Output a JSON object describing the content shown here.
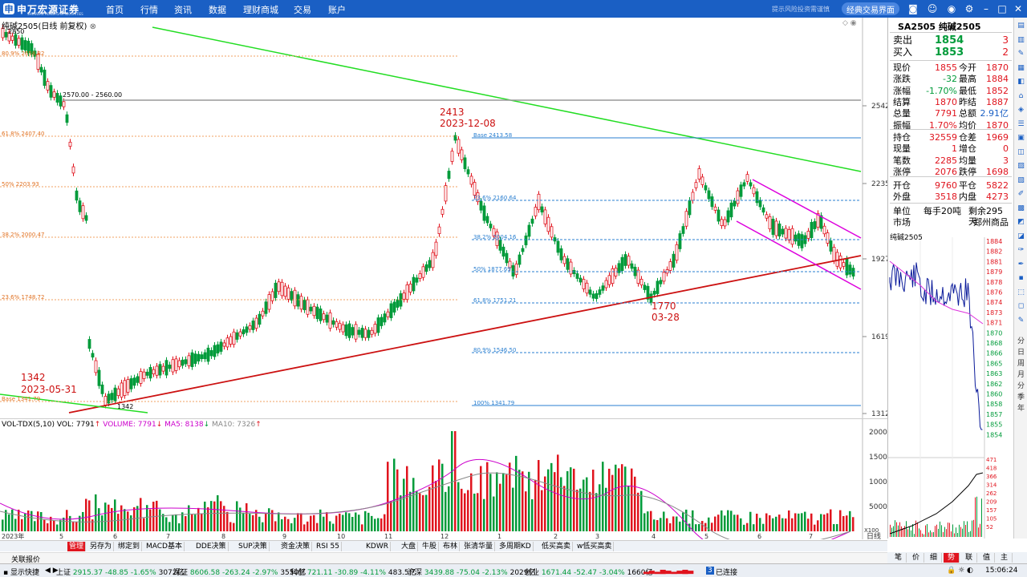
{
  "app": {
    "logo_text": "申万宏源证券",
    "logo_sub": "SHENWAN HONGYUAN SECURITIES",
    "nav": [
      "首页",
      "行情",
      "资讯",
      "数据",
      "理财商城",
      "交易",
      "账户"
    ],
    "topright_text": "提示风险投资需谨慎",
    "classic_button": "经典交易界面"
  },
  "chart": {
    "title": "纯碱2505(日线 前复权)",
    "annotations": {
      "high_price": "2413",
      "high_date": "2023-12-08",
      "low1_price": "1342",
      "low1_date": "2023-05-31",
      "low2_price": "1770",
      "low2_date": "03-28",
      "top_label": "2850",
      "range_label": "2570.00 - 2560.00",
      "bottom_marker": "1342"
    },
    "fib_left": [
      "80.9% 2658.82",
      "61.8% 2407.40",
      "50% 2203.93",
      "38.2% 2000.47",
      "23.6% 1748.72",
      "Base 1341.79"
    ],
    "fib_right": [
      "Base 2413.58",
      "23.6% 2160.64",
      "38.2% 2004.16",
      "50% 1877.69",
      "61.8% 1751.21",
      "80.9% 1546.50",
      "100% 1341.79"
    ],
    "price_axis": [
      "2542",
      "2235",
      "1927",
      "1619",
      "1312"
    ],
    "x_axis": [
      "2023年",
      "5",
      "6",
      "7",
      "8",
      "9",
      "10",
      "11",
      "12",
      "1",
      "2",
      "3",
      "4",
      "5",
      "6",
      "7"
    ],
    "x_axis_right": "日线",
    "zoom_btn": "X100"
  },
  "volume": {
    "indicator": "VOL-TDX(5,10)",
    "vol_label": "VOL: 7791",
    "volume_label": "VOLUME: 7791",
    "ma5_label": "MA5: 8138",
    "ma10_label": "MA10: 7326",
    "axis": [
      "20000",
      "15000",
      "10000",
      "5000"
    ]
  },
  "quote": {
    "code_name": "SA2505 纯碱2505",
    "sell_label": "卖出",
    "sell_price": "1854",
    "sell_qty": "3",
    "buy_label": "买入",
    "buy_price": "1853",
    "buy_qty": "2",
    "rows": [
      [
        "现价",
        "1855",
        "今开",
        "1870"
      ],
      [
        "涨跌",
        "-32",
        "最高",
        "1884"
      ],
      [
        "涨幅",
        "-1.70%",
        "最低",
        "1852"
      ],
      [
        "结算",
        "1870",
        "昨结",
        "1887"
      ],
      [
        "总量",
        "7791",
        "总额",
        "2.91亿"
      ],
      [
        "振幅",
        "1.70%",
        "均价",
        "1870"
      ]
    ],
    "rows2": [
      [
        "持仓",
        "32559",
        "仓差",
        "1969"
      ],
      [
        "现量",
        "1",
        "增仓",
        "0"
      ],
      [
        "笔数",
        "2285",
        "均量",
        "3"
      ],
      [
        "涨停",
        "2076",
        "跌停",
        "1698"
      ]
    ],
    "rows3": [
      [
        "开仓",
        "9760",
        "平仓",
        "5822"
      ],
      [
        "外盘",
        "3518",
        "内盘",
        "4273"
      ]
    ],
    "unit_label": "单位",
    "unit_value": "每手20吨",
    "remain_label": "剩余295天",
    "market_label": "市场",
    "market_value": "郑州商品"
  },
  "mini": {
    "title": "纯碱2505",
    "price_axis": [
      "1884",
      "1882",
      "1881",
      "1879",
      "1878",
      "1876",
      "1874",
      "1873",
      "1871",
      "1870",
      "1868",
      "1866",
      "1865",
      "1863",
      "1862",
      "1860",
      "1858",
      "1857",
      "1855",
      "1854"
    ],
    "vol_axis": [
      "471",
      "418",
      "366",
      "314",
      "262",
      "209",
      "157",
      "105",
      "52"
    ]
  },
  "side_tools": [
    "分",
    "日",
    "周",
    "月",
    "分",
    "季",
    "年"
  ],
  "tabs": [
    "管理",
    "另存为",
    "绑定到",
    "MACD基本",
    "DDE决策",
    "SUP决策",
    "资金决策",
    "RSI 55",
    "KDWR",
    "大盘",
    "牛股",
    "布林",
    "张清华量",
    "多周期KD",
    "低买高卖",
    "w低买高卖"
  ],
  "right_tabs": [
    "笔",
    "价",
    "细",
    "势",
    "联",
    "值",
    "主"
  ],
  "report_label": "关联报价",
  "status": {
    "quick_label": "显示快捷",
    "items": [
      {
        "name": "上证",
        "value": "2915.37",
        "chg": "-48.85",
        "pct": "-1.65%",
        "amt": "3072亿"
      },
      {
        "name": "深证",
        "value": "8606.58",
        "chg": "-263.24",
        "pct": "-2.97%",
        "amt": "3550亿"
      },
      {
        "name": "科创",
        "value": "721.11",
        "chg": "-30.89",
        "pct": "-4.11%",
        "amt": "483.5亿"
      },
      {
        "name": "沪深",
        "value": "3439.88",
        "chg": "-75.04",
        "pct": "-2.13%",
        "amt": "2029亿"
      },
      {
        "name": "创业",
        "value": "1671.44",
        "chg": "-52.47",
        "pct": "-3.04%",
        "amt": "1660亿"
      }
    ],
    "connection_num": "3",
    "connection": "已连接",
    "time": "15:06:24"
  },
  "colors": {
    "nav_bg": "#1a5fc4",
    "up": "#e0141e",
    "down": "#009b3a",
    "trend_green": "#22dd22",
    "trend_red": "#cc1111",
    "channel": "#dd00dd"
  }
}
